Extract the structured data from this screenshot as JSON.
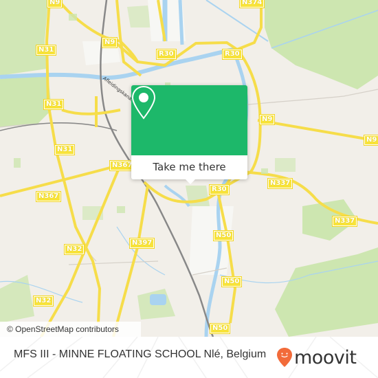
{
  "map": {
    "road_labels": [
      {
        "id": "n9-top",
        "text": "N9"
      },
      {
        "id": "n374",
        "text": "N374"
      },
      {
        "id": "n9-left",
        "text": "N9"
      },
      {
        "id": "n31-a",
        "text": "N31"
      },
      {
        "id": "r30-left",
        "text": "R30"
      },
      {
        "id": "r30-right",
        "text": "R30"
      },
      {
        "id": "n31-b",
        "text": "N31"
      },
      {
        "id": "n9-mid",
        "text": "N9"
      },
      {
        "id": "n9-right",
        "text": "N9"
      },
      {
        "id": "n31-c",
        "text": "N31"
      },
      {
        "id": "n367-top",
        "text": "N367"
      },
      {
        "id": "n367-left",
        "text": "N367"
      },
      {
        "id": "n337-a",
        "text": "N337"
      },
      {
        "id": "r30-south",
        "text": "R30"
      },
      {
        "id": "n337-b",
        "text": "N337"
      },
      {
        "id": "n397",
        "text": "N397"
      },
      {
        "id": "n50-a",
        "text": "N50"
      },
      {
        "id": "n32-a",
        "text": "N32"
      },
      {
        "id": "n50-b",
        "text": "N50"
      },
      {
        "id": "n32-b",
        "text": "N32"
      },
      {
        "id": "n50-c",
        "text": "N50"
      }
    ],
    "street_label": "Afleidingskanaal",
    "attribution": "© OpenStreetMap contributors"
  },
  "popup": {
    "icon": "map-pin-icon",
    "button_label": "Take me there",
    "color": "#1db86a"
  },
  "footer": {
    "location_title": "MFS III - MINNE FLOATING SCHOOL Nlé, Belgium",
    "logo_text": "moovit",
    "logo_color": "#f26b3a"
  }
}
